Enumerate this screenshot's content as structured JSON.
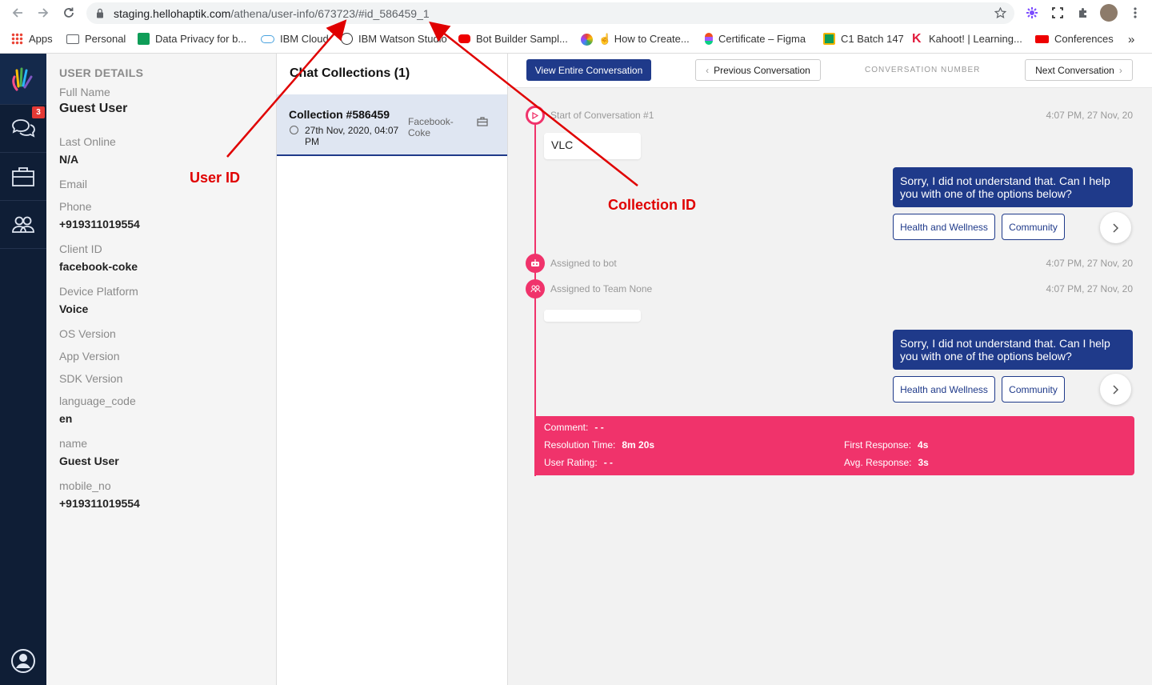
{
  "browser": {
    "url_host": "staging.hellohaptik.com",
    "url_path": "/athena/user-info/673723/#id_586459_1",
    "bookmarks": [
      {
        "label": "Apps",
        "icon": "apps-grid-icon"
      },
      {
        "label": "Personal",
        "icon": "folder-icon"
      },
      {
        "label": "Data Privacy for b...",
        "icon": "sheets-icon"
      },
      {
        "label": "IBM Cloud",
        "icon": "cloud-icon"
      },
      {
        "label": "IBM Watson Studio",
        "icon": "bulb-icon"
      },
      {
        "label": "Bot Builder Sampl...",
        "icon": "youtube-icon"
      },
      {
        "label": "☝ How to Create...",
        "icon": "pinwheel-icon"
      },
      {
        "label": "Certificate – Figma",
        "icon": "figma-icon"
      },
      {
        "label": "C1 Batch 147",
        "icon": "classroom-icon"
      },
      {
        "label": "Kahoot! | Learning...",
        "icon": "kahoot-icon"
      },
      {
        "label": "Conferences",
        "icon": "conference-icon"
      }
    ],
    "more": "»"
  },
  "rail": {
    "badge": "3"
  },
  "user_details": {
    "heading": "USER DETAILS",
    "full_name_label": "Full Name",
    "full_name": "Guest User",
    "last_online_label": "Last Online",
    "last_online": "N/A",
    "email_label": "Email",
    "phone_label": "Phone",
    "phone": "+919311019554",
    "client_id_label": "Client ID",
    "client_id": "facebook-coke",
    "device_platform_label": "Device Platform",
    "device_platform": "Voice",
    "os_version_label": "OS Version",
    "app_version_label": "App Version",
    "sdk_version_label": "SDK Version",
    "language_code_label": "language_code",
    "language_code": "en",
    "name_label": "name",
    "name": "Guest User",
    "mobile_no_label": "mobile_no",
    "mobile_no": "+919311019554"
  },
  "collections": {
    "title": "Chat Collections (1)",
    "item": {
      "name": "Collection #586459",
      "date": "27th Nov, 2020, 04:07 PM",
      "source": "Facebook-Coke"
    }
  },
  "conversation": {
    "view_entire": "View Entire Conversation",
    "previous": "Previous Conversation",
    "number_label": "CONVERSATION NUMBER",
    "next": "Next Conversation",
    "events": {
      "start": "Start of Conversation #1",
      "start_time": "4:07 PM, 27 Nov, 20",
      "bot_assigned": "Assigned to bot",
      "bot_time": "4:07 PM, 27 Nov, 20",
      "team_assigned": "Assigned to Team None",
      "team_time": "4:07 PM, 27 Nov, 20"
    },
    "user_message_1": "VLC",
    "user_message_2": "",
    "bot_message": "Sorry, I did not understand that. Can I help you with one of the options below?",
    "quick_replies": [
      "Health and Wellness",
      "Community"
    ],
    "summary": {
      "comment_label": "Comment:",
      "comment": "- -",
      "resolution_label": "Resolution Time:",
      "resolution": "8m 20s",
      "rating_label": "User Rating:",
      "rating": "- -",
      "first_response_label": "First Response:",
      "first_response": "4s",
      "avg_response_label": "Avg. Response:",
      "avg_response": "3s"
    }
  },
  "annotations": {
    "user_id": "User ID",
    "collection_id": "Collection ID",
    "color": "#e00000"
  },
  "colors": {
    "rail": "#0f1e36",
    "primary": "#1f3a8a",
    "accent": "#f0336b"
  }
}
